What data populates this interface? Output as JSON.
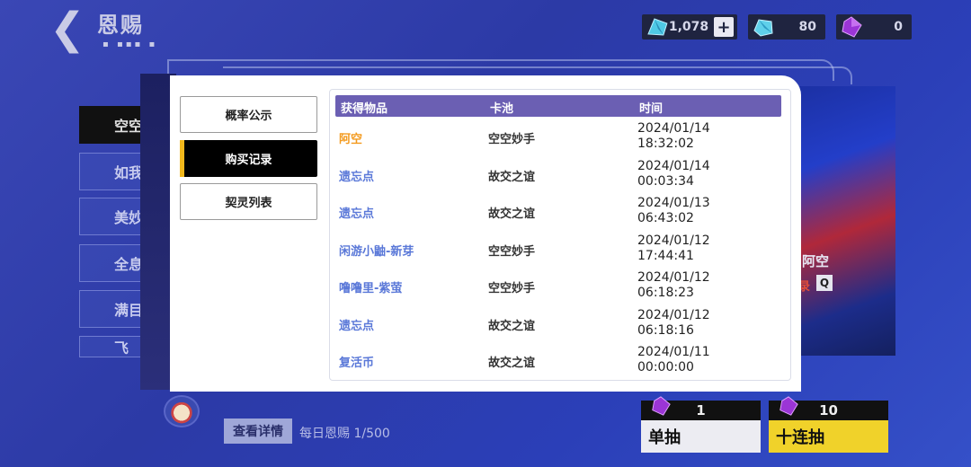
{
  "header": {
    "back_icon": "chevron-left-icon",
    "title": "恩赐",
    "dots": "▪ ▪▪▪ ▪"
  },
  "currencies": [
    {
      "icon": "blue-crystal-icon",
      "value": "1,078",
      "has_plus": true,
      "plus_label": "+"
    },
    {
      "icon": "cyan-crystal-icon",
      "value": "80"
    },
    {
      "icon": "purple-crystal-icon",
      "value": "0"
    }
  ],
  "bg_list": [
    "空空",
    "如我",
    "美妙",
    "全息",
    "满目",
    "飞"
  ],
  "bg_art": {
    "name": "阿空",
    "tag": "录",
    "search_icon": "Q"
  },
  "modal": {
    "tabs": [
      {
        "label": "概率公示",
        "active": false
      },
      {
        "label": "购买记录",
        "active": true
      },
      {
        "label": "契灵列表",
        "active": false
      }
    ],
    "table": {
      "headers": {
        "item": "获得物品",
        "pool": "卡池",
        "time": "时间"
      },
      "rows": [
        {
          "item": "阿空",
          "highlight": true,
          "pool": "空空妙手",
          "date": "2024/01/14",
          "clock": "18:32:02"
        },
        {
          "item": "遗忘点",
          "highlight": false,
          "pool": "故交之谊",
          "date": "2024/01/14",
          "clock": "00:03:34"
        },
        {
          "item": "遗忘点",
          "highlight": false,
          "pool": "故交之谊",
          "date": "2024/01/13",
          "clock": "06:43:02"
        },
        {
          "item": "闲游小鼬-新芽",
          "highlight": false,
          "pool": "空空妙手",
          "date": "2024/01/12",
          "clock": "17:44:41"
        },
        {
          "item": "噜噜里-紫萤",
          "highlight": false,
          "pool": "空空妙手",
          "date": "2024/01/12",
          "clock": "06:18:23"
        },
        {
          "item": "遗忘点",
          "highlight": false,
          "pool": "故交之谊",
          "date": "2024/01/12",
          "clock": "06:18:16"
        },
        {
          "item": "复活币",
          "highlight": false,
          "pool": "故交之谊",
          "date": "2024/01/11",
          "clock": "00:00:00"
        }
      ]
    }
  },
  "footer": {
    "detail_label": "查看详情",
    "daily_text": "每日恩赐 1/500",
    "single": {
      "count": "1",
      "label": "单抽"
    },
    "ten": {
      "count": "10",
      "label": "十连抽"
    }
  },
  "colors": {
    "accent_gold": "#f39a1e",
    "header_purple": "#6b5fb3",
    "link_blue": "#5a78d8",
    "tab_active": "#000000",
    "tab_accent": "#f2b81c"
  }
}
